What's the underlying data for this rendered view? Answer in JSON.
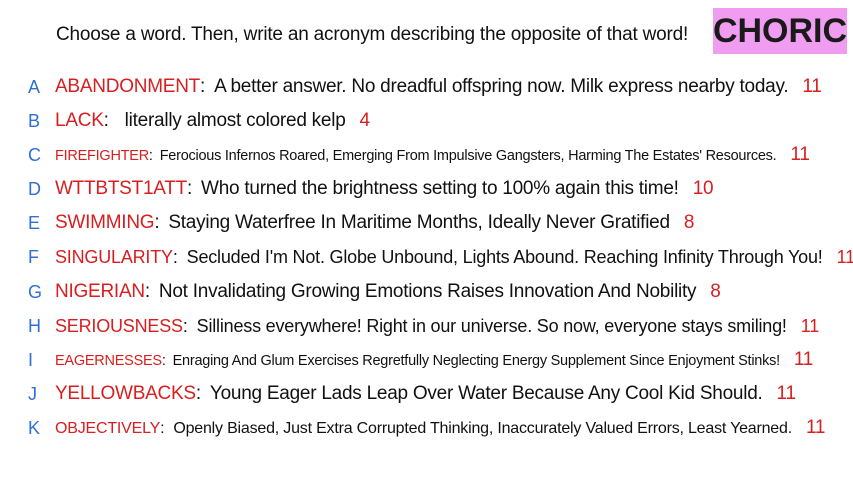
{
  "prompt": "Choose a word. Then, write an acronym describing the opposite of that word!",
  "badge": {
    "label": "CHORIC",
    "color": "#f09cf0"
  },
  "colors": {
    "letter": "#2f6fd6",
    "word": "#d81e1e",
    "text": "#111111"
  },
  "entries": [
    {
      "letter": "A",
      "word": "ABANDONMENT",
      "acronym": "A better answer. No dreadful offspring now. Milk express nearby today.",
      "count": "11"
    },
    {
      "letter": "B",
      "word": "LACK",
      "acronym": "literally almost colored kelp",
      "count": "4"
    },
    {
      "letter": "C",
      "word": "FIREFIGHTER",
      "acronym": "Ferocious Infernos Roared, Emerging From Impulsive Gangsters, Harming The Estates' Resources.",
      "count": "11"
    },
    {
      "letter": "D",
      "word": "WTTBTST1ATT",
      "acronym": "Who turned the brightness setting to 100% again this time!",
      "count": "10"
    },
    {
      "letter": "E",
      "word": "SWIMMING",
      "acronym": "Staying Waterfree In Maritime Months, Ideally Never Gratified",
      "count": "8"
    },
    {
      "letter": "F",
      "word": "SINGULARITY",
      "acronym": "Secluded I'm Not. Globe Unbound, Lights Abound. Reaching Infinity Through You!",
      "count": "11"
    },
    {
      "letter": "G",
      "word": "NIGERIAN",
      "acronym": "Not Invalidating Growing Emotions Raises Innovation And Nobility",
      "count": "8"
    },
    {
      "letter": "H",
      "word": "SERIOUSNESS",
      "acronym": "Silliness everywhere! Right in our universe. So now, everyone stays smiling!",
      "count": "11"
    },
    {
      "letter": "I",
      "word": "EAGERNESSES",
      "acronym": "Enraging And Glum Exercises Regretfully Neglecting Energy Supplement Since Enjoyment Stinks!",
      "count": "11"
    },
    {
      "letter": "J",
      "word": "YELLOWBACKS",
      "acronym": "Young Eager Lads Leap Over Water Because Any Cool Kid Should.",
      "count": "11"
    },
    {
      "letter": "K",
      "word": "OBJECTIVELY",
      "acronym": "Openly Biased, Just Extra Corrupted Thinking, Inaccurately Valued Errors, Least Yearned.",
      "count": "11"
    }
  ]
}
